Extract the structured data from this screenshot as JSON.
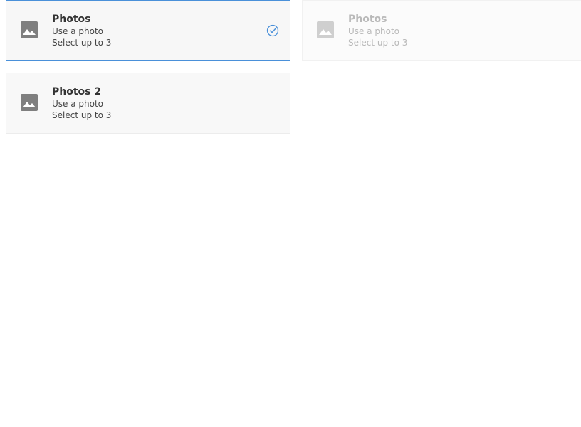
{
  "tiles": [
    {
      "title": "Photos",
      "line1": "Use a photo",
      "line2": "Select up to 3",
      "state": "selected",
      "icon": "image-icon"
    },
    {
      "title": "Photos",
      "line1": "Use a photo",
      "line2": "Select up to 3",
      "state": "disabled",
      "icon": "image-icon"
    },
    {
      "title": "Photos 2",
      "line1": "Use a photo",
      "line2": "Select up to 3",
      "state": "default",
      "icon": "image-icon"
    }
  ],
  "colors": {
    "accent": "#4a90d9",
    "icon": "#7f7f7f",
    "icon_disabled": "#cfcfcf"
  }
}
